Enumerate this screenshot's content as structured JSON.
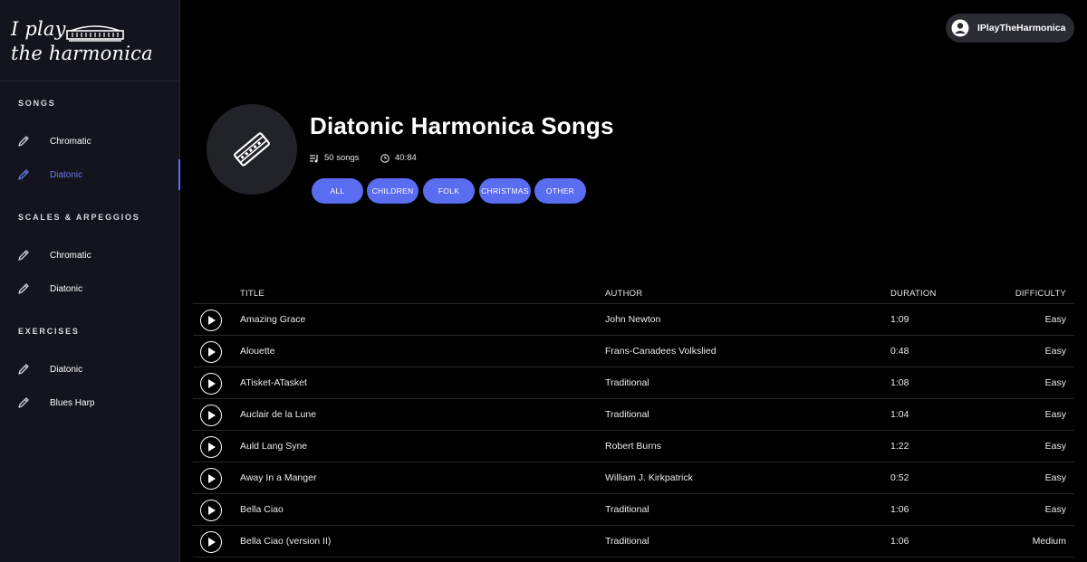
{
  "brand": {
    "line1": "I play",
    "line2": "the harmonica"
  },
  "sidebar": {
    "sections": [
      {
        "title": "SONGS",
        "items": [
          {
            "label": "Chromatic",
            "icon": "pencil-icon"
          },
          {
            "label": "Diatonic",
            "icon": "pencil-icon",
            "active": true
          }
        ]
      },
      {
        "title": "SCALES & ARPEGGIOS",
        "items": [
          {
            "label": "Chromatic",
            "icon": "pencil-icon"
          },
          {
            "label": "Diatonic",
            "icon": "pencil-icon"
          }
        ]
      },
      {
        "title": "EXERCISES",
        "items": [
          {
            "label": "Diatonic",
            "icon": "pencil-icon"
          },
          {
            "label": "Blues Harp",
            "icon": "pencil-icon"
          }
        ]
      }
    ]
  },
  "user": {
    "name": "IPlayTheHarmonica",
    "icon": "user-avatar-icon"
  },
  "header": {
    "title": "Diatonic Harmonica Songs",
    "song_count": "50 songs",
    "duration": "40:84",
    "cover_icon": "harmonica-icon"
  },
  "filters": [
    "ALL",
    "CHILDREN",
    "FOLK",
    "CHRISTMAS",
    "OTHER"
  ],
  "table": {
    "columns": {
      "title": "TITLE",
      "author": "AUTHOR",
      "duration": "DURATION",
      "difficulty": "DIFFICULTY"
    },
    "rows": [
      {
        "title": "Amazing Grace",
        "author": "John Newton",
        "duration": "1:09",
        "difficulty": "Easy"
      },
      {
        "title": "Alouette",
        "author": "Frans-Canadees Volkslied",
        "duration": "0:48",
        "difficulty": "Easy"
      },
      {
        "title": "ATisket-ATasket",
        "author": "Traditional",
        "duration": "1:08",
        "difficulty": "Easy"
      },
      {
        "title": "Auclair de la Lune",
        "author": "Traditional",
        "duration": "1:04",
        "difficulty": "Easy"
      },
      {
        "title": "Auld Lang Syne",
        "author": "Robert Burns",
        "duration": "1:22",
        "difficulty": "Easy"
      },
      {
        "title": "Away In a Manger",
        "author": "William J. Kirkpatrick",
        "duration": "0:52",
        "difficulty": "Easy"
      },
      {
        "title": "Bella Ciao",
        "author": "Traditional",
        "duration": "1:06",
        "difficulty": "Easy"
      },
      {
        "title": "Bella Ciao (version II)",
        "author": "Traditional",
        "duration": "1:06",
        "difficulty": "Medium"
      }
    ]
  },
  "colors": {
    "accent": "#5a6cf0",
    "sidebar_bg": "#13141d",
    "active_text": "#6a7af0"
  }
}
